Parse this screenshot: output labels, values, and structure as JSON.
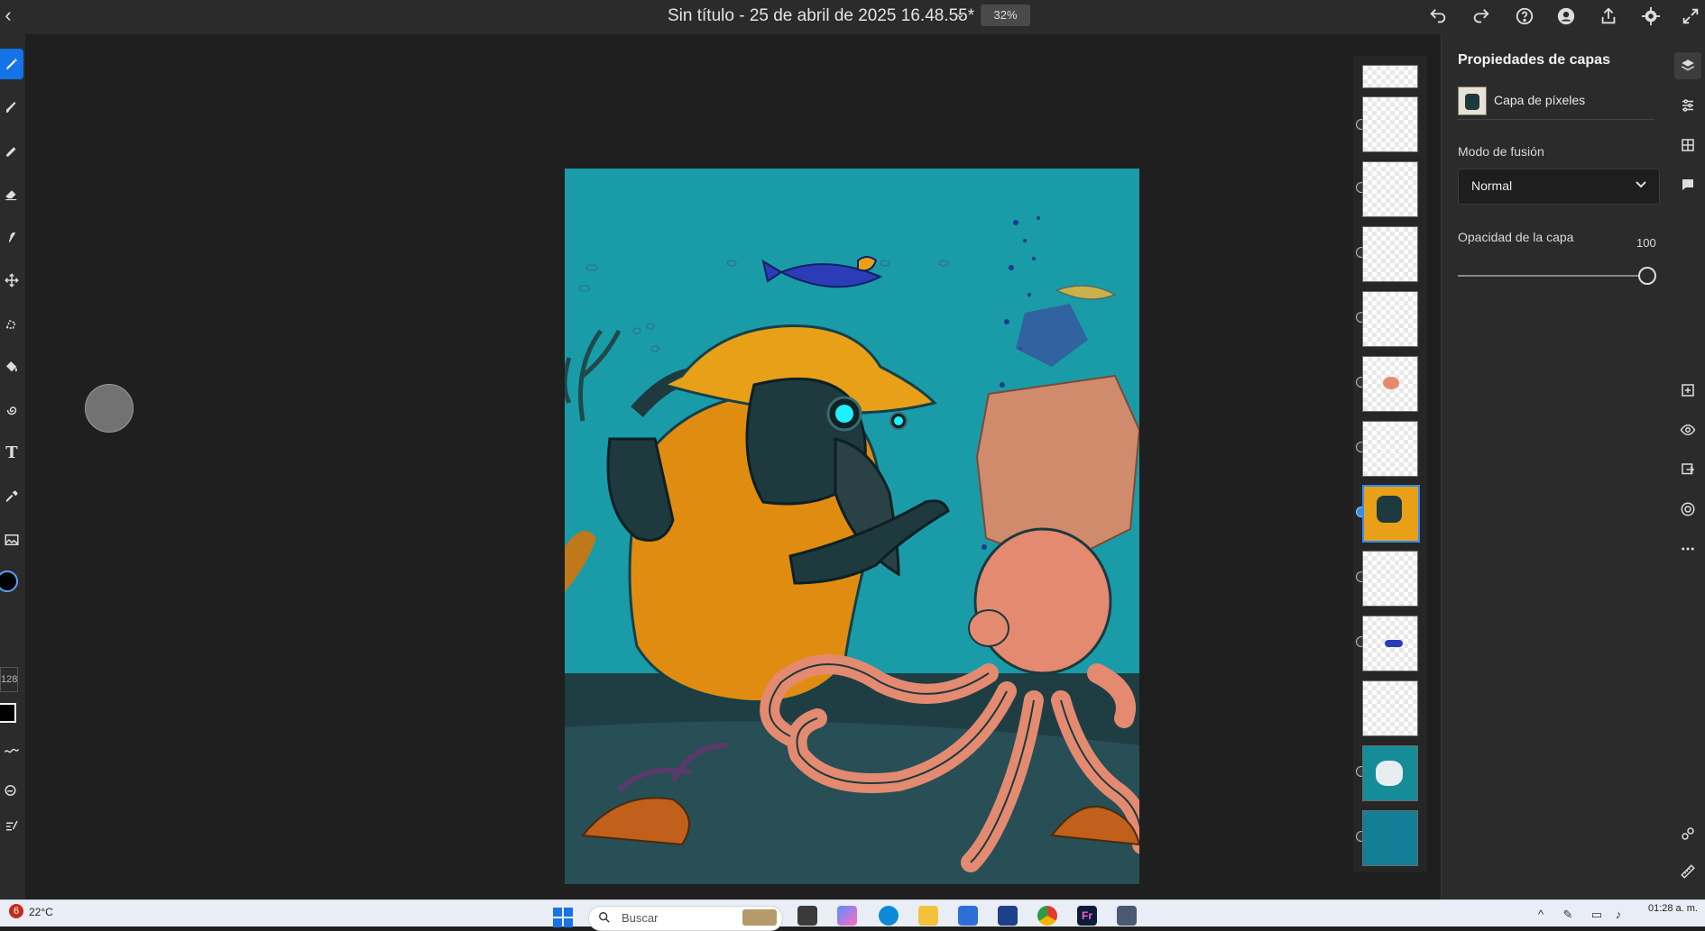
{
  "header": {
    "back_icon": "chevron-left-icon",
    "document_title": "Sin título - 25 de abril de 2025 16.48.55*",
    "zoom": "32%",
    "actions": [
      "undo-icon",
      "redo-icon",
      "help-icon",
      "account-icon",
      "share-icon",
      "settings-icon",
      "expand-icon"
    ]
  },
  "toolbar": {
    "tools": [
      "paint-brush-icon",
      "brush-icon",
      "mixer-brush-icon",
      "eraser-icon",
      "smudge-icon",
      "move-icon",
      "selection-icon",
      "fill-icon",
      "liquify-icon",
      "text-icon",
      "eyedropper-icon",
      "image-icon"
    ],
    "brush_size": "128",
    "primary_color": "#000000"
  },
  "layers_panel": {
    "title": "Propiedades de capas",
    "layer_name": "Capa de píxeles",
    "blend_label": "Modo de fusión",
    "blend_value": "Normal",
    "opacity_label": "Opacidad de la capa",
    "opacity_value": "100",
    "opacity_fraction": 1.0
  },
  "layer_thumbnails": {
    "count": 13,
    "selected_index": 7
  },
  "taskbar": {
    "weather_badge": "6",
    "weather_temp": "22°C",
    "search_placeholder": "Buscar",
    "time": "01:28 a. m."
  },
  "colors": {
    "accent": "#1473e6",
    "ocean": "#1a9ca8",
    "hat": "#e8a018",
    "octopus": "#e48a70"
  }
}
